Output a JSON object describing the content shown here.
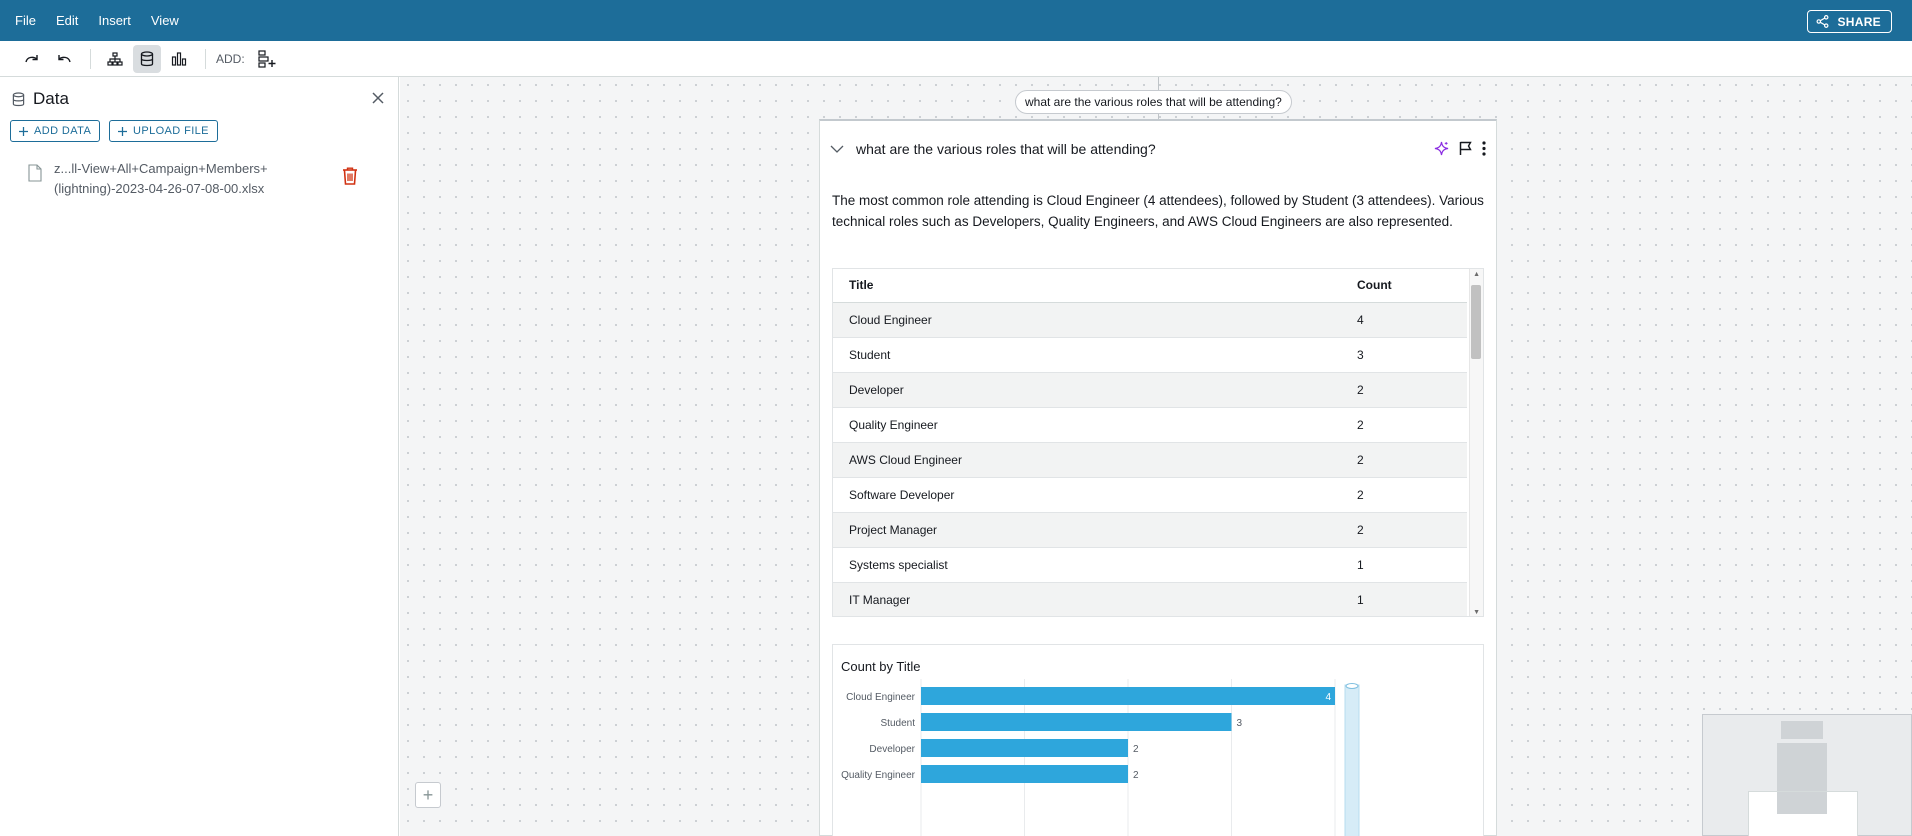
{
  "menu": {
    "items": [
      "File",
      "Edit",
      "Insert",
      "View"
    ],
    "share_label": "SHARE"
  },
  "toolbar": {
    "add_label": "ADD:"
  },
  "data_panel": {
    "title": "Data",
    "add_data_label": "ADD DATA",
    "upload_file_label": "UPLOAD FILE",
    "file_line1": "z...ll-View+All+Campaign+Members+",
    "file_line2": "(lightning)-2023-04-26-07-08-00.xlsx"
  },
  "canvas": {
    "question_pill": "what are the various roles that will be attending?"
  },
  "card": {
    "title": "what are the various roles that will be attending?",
    "summary": "The most common role attending is Cloud Engineer (4 attendees), followed by Student (3 attendees). Various technical roles such as Developers, Quality Engineers, and AWS Cloud Engineers are also represented.",
    "table": {
      "headers": [
        "Title",
        "Count"
      ],
      "rows": [
        [
          "Cloud Engineer",
          "4"
        ],
        [
          "Student",
          "3"
        ],
        [
          "Developer",
          "2"
        ],
        [
          "Quality Engineer",
          "2"
        ],
        [
          "AWS Cloud Engineer",
          "2"
        ],
        [
          "Software Developer",
          "2"
        ],
        [
          "Project Manager",
          "2"
        ],
        [
          "Systems specialist",
          "1"
        ],
        [
          "IT Manager",
          "1"
        ]
      ]
    }
  },
  "colors": {
    "header_bg": "#1d6d99",
    "bar": "#2ea6dc",
    "delete": "#d13212",
    "ai_sparkle": "#8a2be2"
  },
  "chart_data": {
    "type": "bar",
    "orientation": "horizontal",
    "title": "Count by Title",
    "categories": [
      "Cloud Engineer",
      "Student",
      "Developer",
      "Quality Engineer"
    ],
    "values": [
      4,
      3,
      2,
      2
    ],
    "xlim": [
      0,
      4
    ]
  }
}
